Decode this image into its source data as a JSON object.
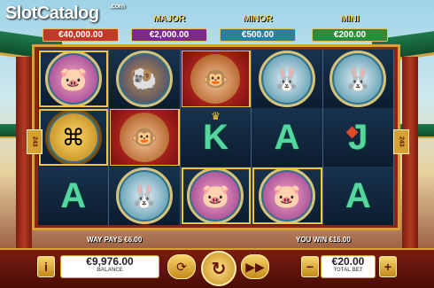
{
  "logo": {
    "text": "SlotCatalog",
    "suffix": ".com"
  },
  "jackpots": [
    {
      "name": "",
      "value": "€40,000.00",
      "color": "#c0392b"
    },
    {
      "name": "MAJOR",
      "value": "€2,000.00",
      "color": "#7b2a8c"
    },
    {
      "name": "MINOR",
      "value": "€500.00",
      "color": "#2f7f9a"
    },
    {
      "name": "MINI",
      "value": "€200.00",
      "color": "#2f8a3a"
    }
  ],
  "ways": {
    "left": "243",
    "right": "243"
  },
  "reels": [
    [
      "pig",
      "coin",
      "letter-A"
    ],
    [
      "ram",
      "monkey",
      "rabbit"
    ],
    [
      "monkey",
      "letter-K",
      "pig"
    ],
    [
      "rabbit",
      "letter-A",
      "pig"
    ],
    [
      "rabbit",
      "letter-J",
      "letter-A"
    ]
  ],
  "status": {
    "ways_pays": "WAY PAYS €6.00",
    "you_win": "YOU WIN €16.00"
  },
  "controls": {
    "info_icon": "i",
    "balance_value": "€9,976.00",
    "balance_label": "BALANCE",
    "autoplay_icon": "autoplay-icon",
    "spin_icon": "spin-icon",
    "turbo_icon": "turbo-icon",
    "minus": "−",
    "bet_value": "€20.00",
    "bet_label": "TOTAL BET",
    "plus": "+"
  },
  "colors": {
    "frame": "#8e2415",
    "gold": "#d6a032",
    "letter": "#55d6a0"
  }
}
